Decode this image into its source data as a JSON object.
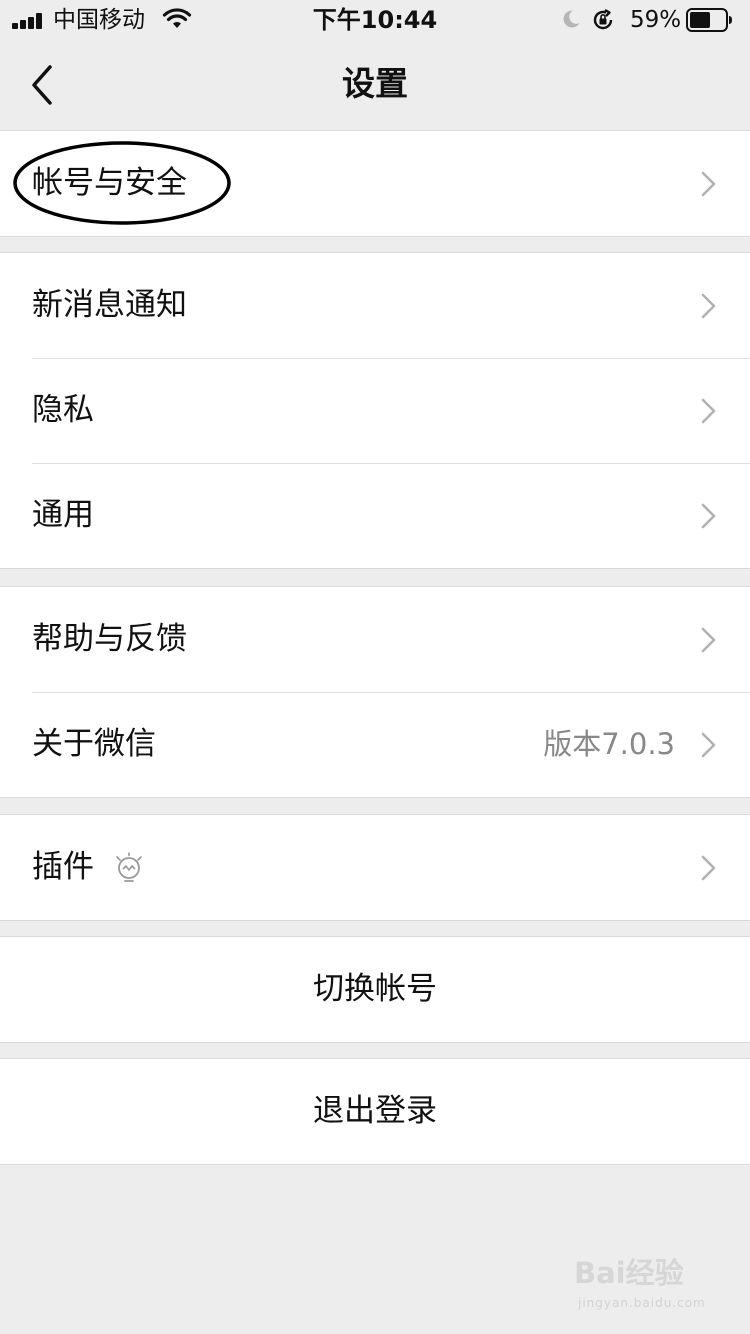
{
  "status_bar": {
    "carrier": "中国移动",
    "time": "下午10:44",
    "battery_percent": "59%",
    "battery_level": 0.59,
    "icons": [
      "signal-icon",
      "wifi-icon",
      "moon-icon",
      "rotation-lock-icon",
      "battery-icon"
    ]
  },
  "nav": {
    "back_icon": "chevron-left-icon",
    "title": "设置"
  },
  "groups": [
    {
      "items": [
        {
          "label": "帐号与安全",
          "chevron": "chevron-right-icon"
        }
      ]
    },
    {
      "items": [
        {
          "label": "新消息通知",
          "chevron": "chevron-right-icon"
        },
        {
          "label": "隐私",
          "chevron": "chevron-right-icon"
        },
        {
          "label": "通用",
          "chevron": "chevron-right-icon"
        }
      ]
    },
    {
      "items": [
        {
          "label": "帮助与反馈",
          "chevron": "chevron-right-icon"
        },
        {
          "label": "关于微信",
          "value": "版本7.0.3",
          "chevron": "chevron-right-icon"
        }
      ]
    },
    {
      "items": [
        {
          "label": "插件",
          "icon": "lightbulb-icon",
          "chevron": "chevron-right-icon"
        }
      ]
    }
  ],
  "actions": {
    "switch_account": "切换帐号",
    "logout": "退出登录"
  },
  "watermark": {
    "text": "Bai经验",
    "sub": "jingyan.baidu.com"
  },
  "colors": {
    "background": "#ededed",
    "cell_background": "#ffffff",
    "separator": "#e0e0e0",
    "secondary_text": "#888888",
    "annotation_oval": "#000000"
  }
}
